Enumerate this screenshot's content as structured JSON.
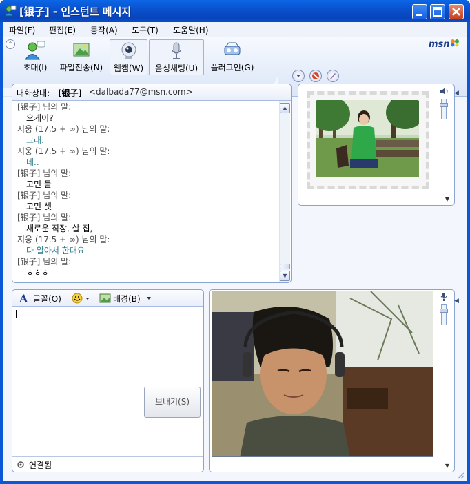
{
  "window": {
    "title": "[银子] - 인스턴트 메시지",
    "controls": [
      "minimize",
      "maximize",
      "close"
    ]
  },
  "menu": {
    "items": [
      "파일(F)",
      "편집(E)",
      "동작(A)",
      "도구(T)",
      "도움말(H)"
    ]
  },
  "toolbar": {
    "tools": [
      {
        "label": "초대(I)",
        "icon": "invite-icon"
      },
      {
        "label": "파일전송(N)",
        "icon": "file-transfer-icon"
      },
      {
        "label": "웹캠(W)",
        "icon": "webcam-icon",
        "selected": true
      },
      {
        "label": "음성채팅(U)",
        "icon": "microphone-icon",
        "selected": true
      },
      {
        "label": "플러그인(G)",
        "icon": "plugin-icon"
      }
    ],
    "brand": "msn"
  },
  "conversation": {
    "header_label": "대화상대:",
    "contact_name": "[银子]",
    "contact_email": "<dalbada77@msn.com>",
    "lines": [
      {
        "type": "sender",
        "text": "[银子] 님의 말:"
      },
      {
        "type": "msg",
        "text": "오케이?"
      },
      {
        "type": "sender",
        "text": "지웅 (17.5 + ∞) 님의 말:"
      },
      {
        "type": "msg-blue",
        "text": "그래."
      },
      {
        "type": "sender",
        "text": "지웅 (17.5 + ∞) 님의 말:"
      },
      {
        "type": "msg-blue",
        "text": "네.."
      },
      {
        "type": "sender",
        "text": "[银子] 님의 말:"
      },
      {
        "type": "msg",
        "text": "고민 둘"
      },
      {
        "type": "sender",
        "text": "[银子] 님의 말:"
      },
      {
        "type": "msg",
        "text": "고민 셋"
      },
      {
        "type": "sender",
        "text": "[银子] 님의 말:"
      },
      {
        "type": "msg",
        "text": "새로운 직장, 살 집,"
      },
      {
        "type": "sender",
        "text": "지웅 (17.5 + ∞) 님의 말:"
      },
      {
        "type": "msg-blue",
        "text": "다 알아서 한대요"
      },
      {
        "type": "sender",
        "text": "[银子] 님의 말:"
      },
      {
        "type": "msg",
        "text": "ㅎㅎㅎ"
      }
    ]
  },
  "compose": {
    "font_label": "글꼴(O)",
    "background_label": "배경(B)",
    "send_label": "보내기(S)",
    "status": "연결됨"
  },
  "colors": {
    "title_blue": "#0a58d8",
    "panel_border": "#8aa4d2",
    "my_message": "#2a7c8c"
  }
}
